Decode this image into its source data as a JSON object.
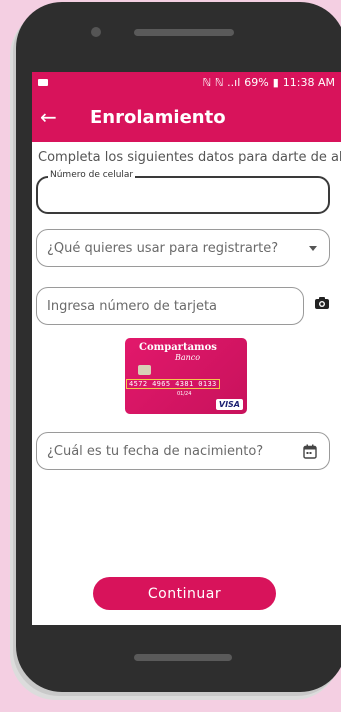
{
  "status_bar": {
    "icons_text": "ℕ ℕ ..ıl",
    "battery": "69%",
    "time": "11:38 AM"
  },
  "app_bar": {
    "back_icon": "←",
    "title": "Enrolamiento"
  },
  "form": {
    "intro": "Completa los siguientes datos para darte de alta",
    "phone_label": "Número de celular",
    "phone_value": "",
    "register_with_placeholder": "¿Qué quieres usar para registrarte?",
    "card_number_placeholder": "Ingresa número de tarjeta",
    "birthdate_placeholder": "¿Cuál es tu fecha de nacimiento?"
  },
  "card_image": {
    "brand": "Compartamos",
    "sub": "Banco",
    "number": "4572 4965 4381 0133",
    "expiry": "01/24",
    "network": "VISA"
  },
  "actions": {
    "continue_label": "Continuar"
  },
  "colors": {
    "primary": "#d8135b",
    "background": "#f4cfe2",
    "phone_frame": "#2e2e2e"
  }
}
